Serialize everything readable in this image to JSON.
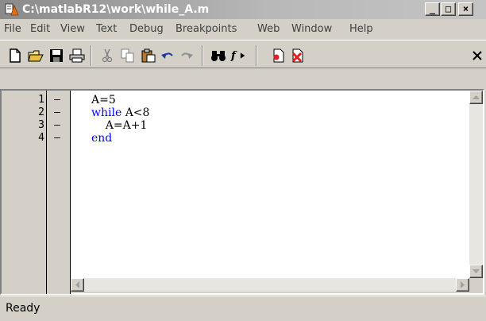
{
  "window": {
    "title": "C:\\matlabR12\\work\\while_A.m",
    "minimize_glyph": "_",
    "maximize_glyph": "□",
    "close_glyph": "×"
  },
  "menu": {
    "items": [
      "File",
      "Edit",
      "View",
      "Text",
      "Debug",
      "Breakpoints",
      "Web",
      "Window",
      "Help"
    ]
  },
  "toolbar": {
    "buttons": [
      "new-file-icon",
      "open-folder-icon",
      "save-icon",
      "print-icon",
      "cut-icon",
      "copy-icon",
      "paste-icon",
      "undo-icon",
      "redo-icon",
      "find-icon",
      "function-icon",
      "run-icon",
      "clear-breakpoints-icon",
      "close-icon"
    ]
  },
  "editor": {
    "lines": [
      {
        "number": "1",
        "marker": "–",
        "code": "A=5"
      },
      {
        "number": "2",
        "marker": "–",
        "keyword": "while",
        "code": " A<8"
      },
      {
        "number": "3",
        "marker": "–",
        "code": "    A=A+1"
      },
      {
        "number": "4",
        "marker": "–",
        "keyword": "end",
        "code": ""
      }
    ]
  },
  "status": {
    "text": "Ready"
  },
  "colors": {
    "keyword": "#0000ff",
    "chrome": "#d4d0c8",
    "title_gradient_start": "#8a8a8a"
  }
}
